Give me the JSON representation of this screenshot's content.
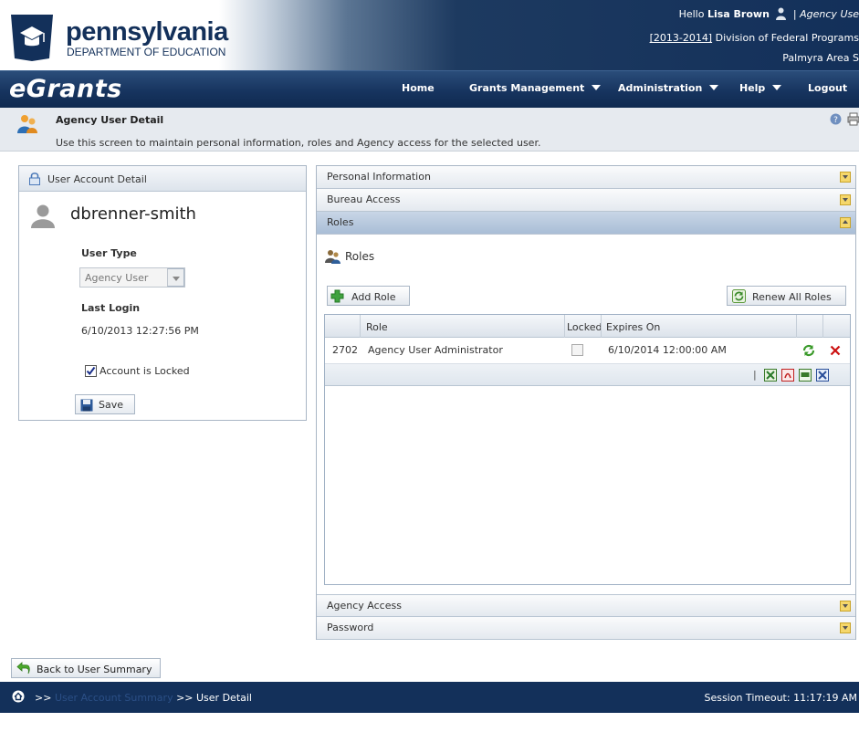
{
  "header": {
    "logo_title": "pennsylvania",
    "logo_subtitle": "DEPARTMENT OF EDUCATION",
    "greeting": "Hello",
    "user_name": "Lisa Brown",
    "separator": "|",
    "user_role": "Agency Use",
    "year": "[2013-2014]",
    "division": "Division of Federal Programs",
    "org": "Palmyra Area S",
    "app_name": "eGrants"
  },
  "nav": {
    "home": "Home",
    "grants": "Grants Management",
    "admin": "Administration",
    "help": "Help",
    "logout": "Logout"
  },
  "page": {
    "title": "Agency User Detail",
    "description": "Use this screen to maintain personal information, roles and Agency access for the selected user."
  },
  "user_panel": {
    "header": "User Account Detail",
    "username": "dbrenner-smith",
    "user_type_label": "User Type",
    "user_type_value": "Agency User",
    "last_login_label": "Last Login",
    "last_login_value": "6/10/2013 12:27:56 PM",
    "locked_label": "Account is Locked",
    "locked": true,
    "save_label": "Save"
  },
  "accordion": {
    "personal": "Personal Information",
    "bureau": "Bureau Access",
    "roles": "Roles",
    "agency": "Agency Access",
    "password": "Password"
  },
  "roles": {
    "section_title": "Roles",
    "add_label": "Add Role",
    "renew_label": "Renew All Roles",
    "columns": {
      "role": "Role",
      "locked": "Locked",
      "expires": "Expires On"
    },
    "rows": [
      {
        "id": "2702",
        "role": "Agency User Administrator",
        "locked": false,
        "expires": "6/10/2014 12:00:00 AM"
      }
    ],
    "footer_separator": "|"
  },
  "bottom": {
    "back_label": "Back to User Summary",
    "crumb_sep1": ">>",
    "crumb_link": "User Account Summary",
    "crumb_current": ">> User Detail",
    "session": "Session Timeout: 11:17:19 AM"
  },
  "colors": {
    "navy": "#13305a",
    "accent_yellow": "#f5d76b",
    "delete_red": "#cc1111"
  }
}
